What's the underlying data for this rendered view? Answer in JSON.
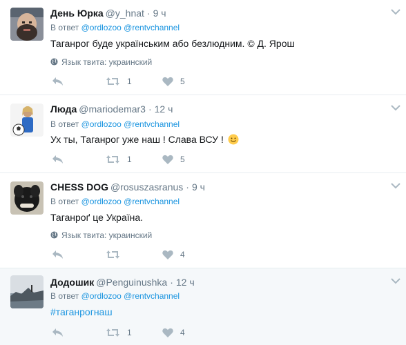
{
  "tweets": [
    {
      "name": "День Юрка",
      "handle": "@y_hnat",
      "time": "9 ч",
      "reply_prefix": "В ответ",
      "mentions": [
        "@ordlozoo",
        "@rentvchannel"
      ],
      "text": "Таганрог буде українським або безлюдним. © Д. Ярош",
      "language": "Язык твита: украинский",
      "retweets": "1",
      "likes": "5",
      "avatar": "bearded-man-photo"
    },
    {
      "name": "Люда",
      "handle": "@mariodemar3",
      "time": "12 ч",
      "reply_prefix": "В ответ",
      "mentions": [
        "@ordlozoo",
        "@rentvchannel"
      ],
      "text": "Ух ты, Таганрог уже наш ! Слава ВСУ !",
      "emoji": "slightly-smiling-face",
      "retweets": "1",
      "likes": "5",
      "avatar": "woman-with-soccer-ball-photo"
    },
    {
      "name": "CHESS DOG",
      "handle": "@rosuszasranus",
      "time": "9 ч",
      "reply_prefix": "В ответ",
      "mentions": [
        "@ordlozoo",
        "@rentvchannel"
      ],
      "text": "Таганроґ це Україна.",
      "language": "Язык твита: украинский",
      "retweets": "",
      "likes": "4",
      "avatar": "black-dog-photo"
    },
    {
      "name": "Додошик",
      "handle": "@Penguinushka",
      "time": "12 ч",
      "reply_prefix": "В ответ",
      "mentions": [
        "@ordlozoo",
        "@rentvchannel"
      ],
      "hashtag": "#таганрогнаш",
      "retweets": "1",
      "likes": "4",
      "avatar": "seaside-landscape-photo"
    }
  ],
  "colors": {
    "link": "#1b95e0",
    "secondary": "#657786",
    "text": "#14171a",
    "icon": "#aab8c2",
    "highlight_bg": "#f5f8fa"
  }
}
